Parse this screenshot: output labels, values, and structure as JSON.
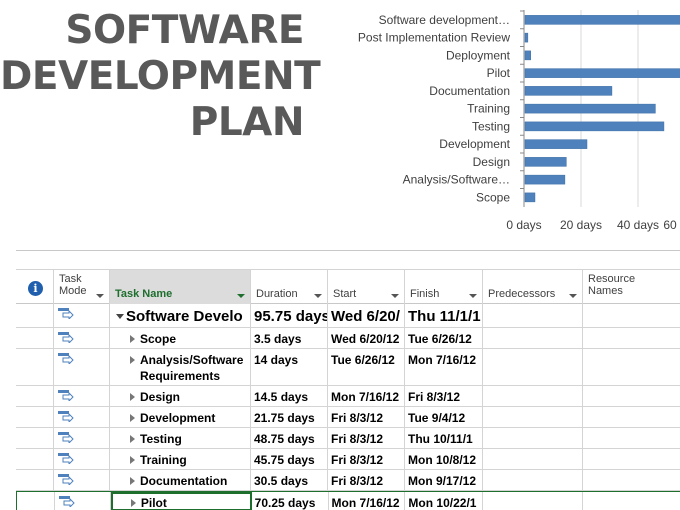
{
  "title": {
    "lines": [
      "SOFTWARE",
      "DEVELOPMENT",
      "PLAN"
    ]
  },
  "chart_data": {
    "type": "bar",
    "orientation": "horizontal",
    "categories": [
      "Software development…",
      "Post Implementation Review",
      "Deployment",
      "Pilot",
      "Documentation",
      "Training",
      "Testing",
      "Development",
      "Design",
      "Analysis/Software…",
      "Scope"
    ],
    "values": [
      95.75,
      1,
      2,
      70.25,
      30.5,
      45.75,
      48.75,
      21.75,
      14.5,
      14,
      3.5
    ],
    "x_ticks": [
      "0 days",
      "20 days",
      "40 days",
      "60"
    ],
    "xlim": [
      0,
      60
    ],
    "grid": true,
    "bar_color": "#4f81bd"
  },
  "grid": {
    "columns": {
      "info": "i",
      "mode": "Task Mode",
      "name": "Task Name",
      "duration": "Duration",
      "start": "Start",
      "finish": "Finish",
      "predecessors": "Predecessors",
      "resource": "Resource Names"
    },
    "rows": [
      {
        "name": "Software Develo",
        "duration": "95.75 days",
        "start": "Wed 6/20/",
        "finish": "Thu 11/1/1",
        "summary": true
      },
      {
        "name": "Scope",
        "duration": "3.5 days",
        "start": "Wed 6/20/12",
        "finish": "Tue 6/26/12"
      },
      {
        "name": "Analysis/Software Requirements",
        "duration": "14 days",
        "start": "Tue 6/26/12",
        "finish": "Mon 7/16/12"
      },
      {
        "name": "Design",
        "duration": "14.5 days",
        "start": "Mon 7/16/12",
        "finish": "Fri 8/3/12"
      },
      {
        "name": "Development",
        "duration": "21.75 days",
        "start": "Fri 8/3/12",
        "finish": "Tue 9/4/12"
      },
      {
        "name": "Testing",
        "duration": "48.75 days",
        "start": "Fri 8/3/12",
        "finish": "Thu 10/11/1"
      },
      {
        "name": "Training",
        "duration": "45.75 days",
        "start": "Fri 8/3/12",
        "finish": "Mon 10/8/12"
      },
      {
        "name": "Documentation",
        "duration": "30.5 days",
        "start": "Fri 8/3/12",
        "finish": "Mon 9/17/12"
      },
      {
        "name": "Pilot",
        "duration": "70.25 days",
        "start": "Mon 7/16/12",
        "finish": "Mon 10/22/1",
        "selected": true
      }
    ]
  },
  "colors": {
    "accent_green": "#1e6e2e",
    "info_blue": "#1f5fae",
    "bar_blue": "#4f81bd"
  }
}
